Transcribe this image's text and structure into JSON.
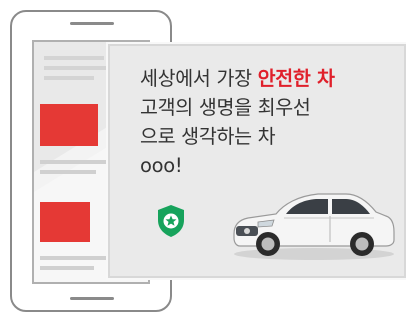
{
  "promo": {
    "line1_prefix": "세상에서 가장 ",
    "line1_accent": "안전한 차",
    "line2": "고객의 생명을 최우선",
    "line3": "으로 생각하는 차",
    "line4": "ooo!"
  },
  "icons": {
    "shield": "shield-check-icon",
    "car": "sedan-car-icon"
  },
  "colors": {
    "accent": "#e0202b",
    "shield_green": "#17a35c",
    "placeholder_red": "#e53935",
    "frame_gray": "#8a8a8a"
  }
}
